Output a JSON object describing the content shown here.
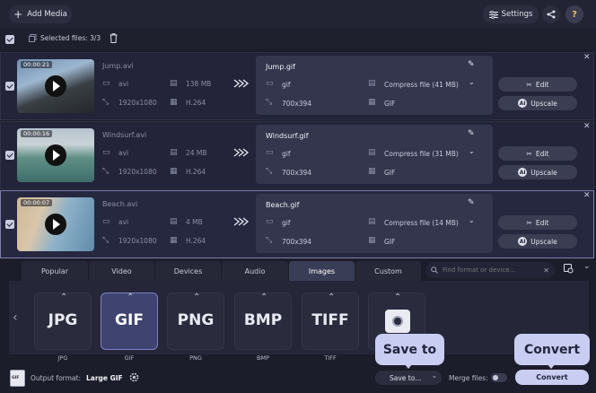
{
  "toolbar": {
    "add_media": "Add Media",
    "settings": "Settings"
  },
  "selection": {
    "label": "Selected files: 3/3"
  },
  "files": [
    {
      "duration": "00:00:21",
      "name": "Jump.avi",
      "container": "avi",
      "size": "138 MB",
      "resolution": "1920x1080",
      "codec": "H.264",
      "out_name": "Jump.gif",
      "out_container": "gif",
      "out_compress": "Compress file (41 MB)",
      "out_resolution": "700x394",
      "out_codec": "GIF"
    },
    {
      "duration": "00:00:16",
      "name": "Windsurf.avi",
      "container": "avi",
      "size": "24 MB",
      "resolution": "1920x1080",
      "codec": "H.264",
      "out_name": "Windsurf.gif",
      "out_container": "gif",
      "out_compress": "Compress file (31 MB)",
      "out_resolution": "700x394",
      "out_codec": "GIF"
    },
    {
      "duration": "00:00:07",
      "name": "Beach.avi",
      "container": "avi",
      "size": "4 MB",
      "resolution": "1920x1080",
      "codec": "H.264",
      "out_name": "Beach.gif",
      "out_container": "gif",
      "out_compress": "Compress file (14 MB)",
      "out_resolution": "700x394",
      "out_codec": "GIF"
    }
  ],
  "actions": {
    "edit": "Edit",
    "upscale": "Upscale"
  },
  "tabs": [
    "Popular",
    "Video",
    "Devices",
    "Audio",
    "Images",
    "Custom"
  ],
  "search": {
    "placeholder": "Find format or device..."
  },
  "formats": [
    {
      "logo": "JPG",
      "label": "JPG"
    },
    {
      "logo": "GIF",
      "label": "GIF"
    },
    {
      "logo": "PNG",
      "label": "PNG"
    },
    {
      "logo": "BMP",
      "label": "BMP"
    },
    {
      "logo": "TIFF",
      "label": "TIFF"
    },
    {
      "logo": "",
      "label": ""
    }
  ],
  "bottom": {
    "output_label": "Output format:",
    "output_value": "Large GIF",
    "save_to": "Save to...",
    "merge": "Merge files:",
    "convert": "Convert",
    "file_icon_text": "GIF"
  },
  "tooltips": {
    "save_to": "Save to",
    "convert": "Convert"
  },
  "colors": {
    "accent": "#c9cdf2",
    "selected_format": "#3e4370",
    "background": "#1c1d2a"
  }
}
